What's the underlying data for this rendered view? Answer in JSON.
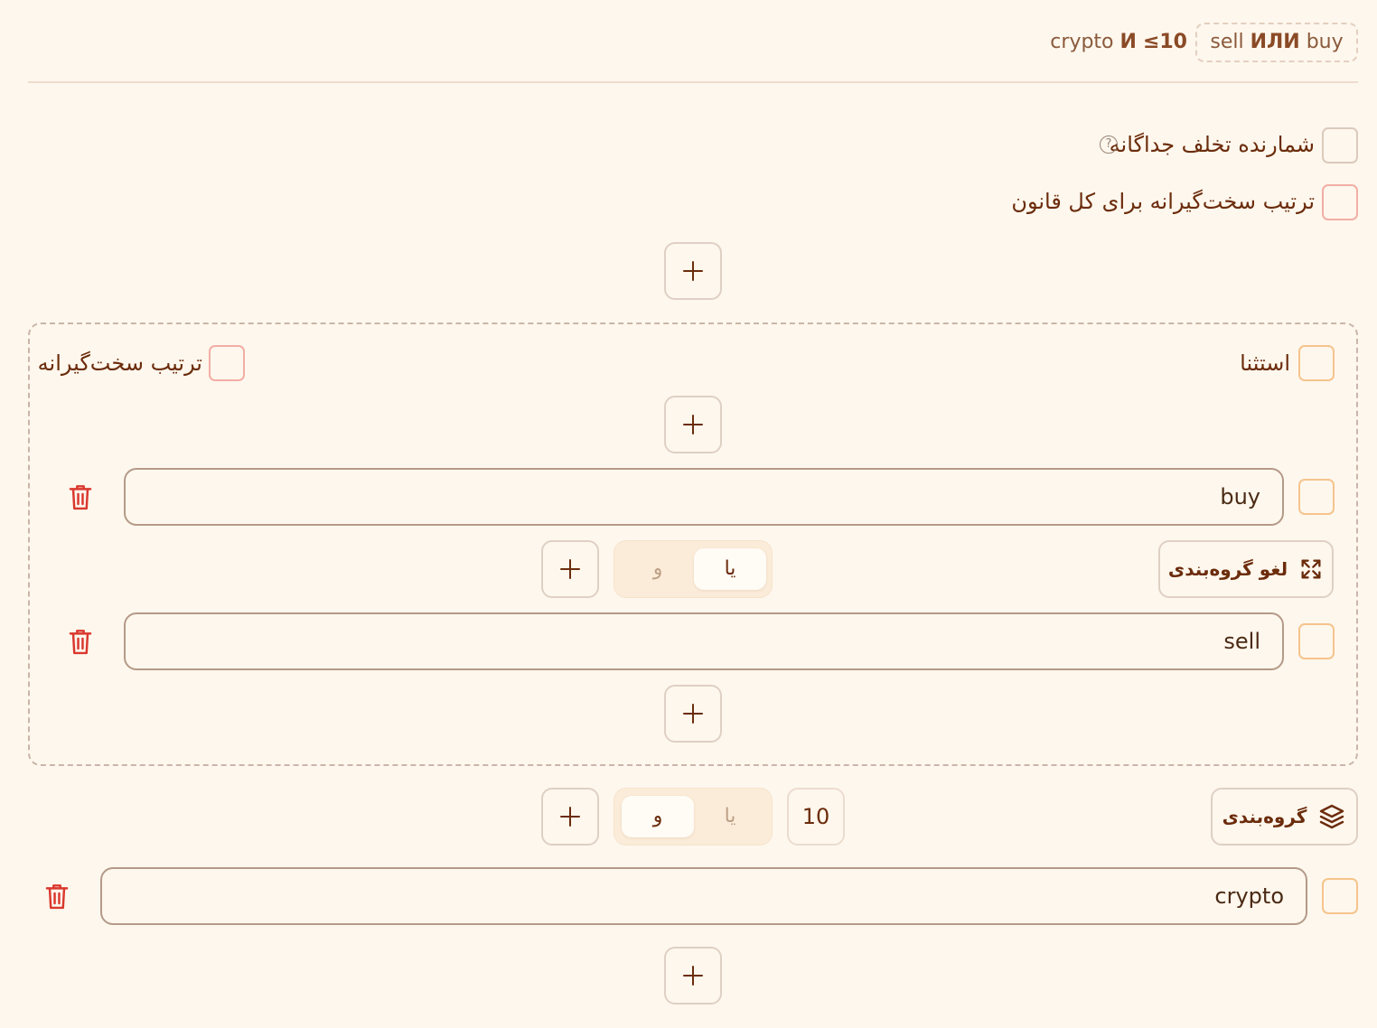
{
  "summary": {
    "part1": "crypto",
    "and_word": "И",
    "limit": "≤10",
    "badge_a": "sell",
    "or_word": "ИЛИ",
    "badge_b": "buy"
  },
  "rule_options": {
    "separate_counter_label": "شمارنده تخلف جداگانه",
    "help_glyph": "?",
    "strict_order_rule_label": "ترتیب سخت‌گیرانه برای کل قانون"
  },
  "group": {
    "exception_label": "استثنا",
    "strict_order_label": "ترتیب سخت‌گیرانه",
    "terms": [
      {
        "value": "buy"
      },
      {
        "value": "sell"
      }
    ],
    "ungroup_label": "لغو گروه‌بندی",
    "operator": {
      "or_label": "یا",
      "and_label": "و",
      "selected": "یا"
    }
  },
  "outer": {
    "group_label": "گروه‌بندی",
    "operator": {
      "or_label": "یا",
      "and_label": "و",
      "selected": "و"
    },
    "count": "10",
    "terms": [
      {
        "value": "crypto"
      }
    ]
  },
  "colors": {
    "background": "#fef7ed",
    "text_primary": "#6b2c0c",
    "delete": "#d9382e",
    "checkbox_red": "#f2aea5",
    "checkbox_orange": "#f6c48d"
  },
  "icons": {
    "add": "plus-icon",
    "delete": "trash-icon",
    "ungroup": "expand-arrows-icon",
    "group": "layers-icon",
    "help": "question-circle-icon"
  }
}
